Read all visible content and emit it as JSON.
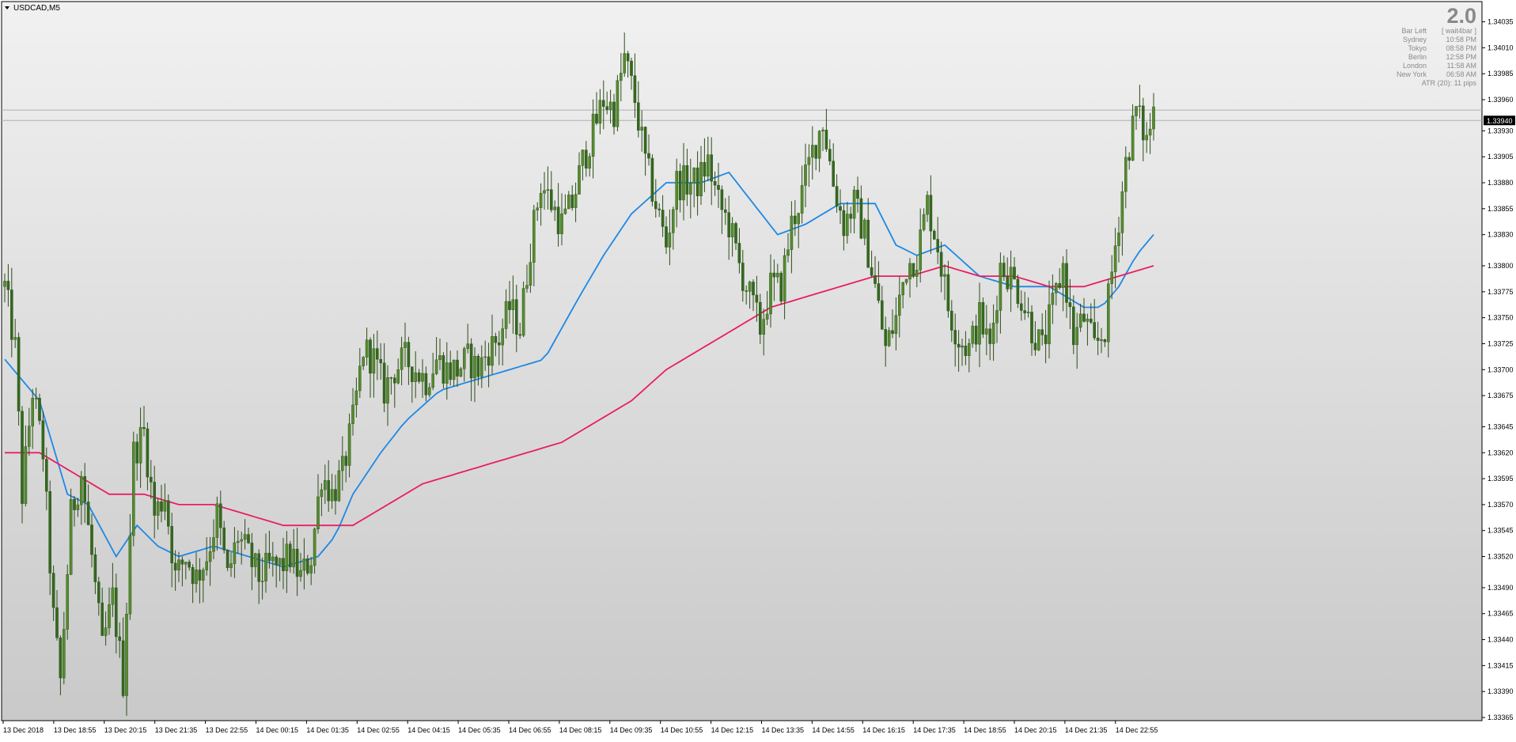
{
  "window": {
    "symbol_label": "USDCAD,M5"
  },
  "info_panel": {
    "version": "2.0",
    "rows": [
      {
        "label": "Bar Left",
        "value": "[ wait4bar ]"
      },
      {
        "label": "Sydney",
        "value": "10:58 PM"
      },
      {
        "label": "Tokyo",
        "value": "08:58 PM"
      },
      {
        "label": "Berlin",
        "value": "12:58 PM"
      },
      {
        "label": "London",
        "value": "11:58 AM"
      },
      {
        "label": "New York",
        "value": "06:58 AM"
      }
    ],
    "atr": "ATR (20): 11 pips"
  },
  "colors": {
    "bull_candle": "#558b2f",
    "bear_candle": "#33691e",
    "wick": "#2e4d1a",
    "ma_fast": "#1e88e5",
    "ma_slow": "#e91e63",
    "price_tag_bg": "#000000",
    "price_tag_fg": "#ffffff"
  },
  "chart_data": {
    "type": "candlestick",
    "title": "USDCAD,M5",
    "ylim": [
      1.33365,
      1.3404
    ],
    "y_ticks": [
      "1.34035",
      "1.34010",
      "1.33985",
      "1.33960",
      "1.33930",
      "1.33905",
      "1.33880",
      "1.33855",
      "1.33830",
      "1.33800",
      "1.33775",
      "1.33750",
      "1.33725",
      "1.33700",
      "1.33675",
      "1.33645",
      "1.33620",
      "1.33595",
      "1.33570",
      "1.33545",
      "1.33520",
      "1.33490",
      "1.33465",
      "1.33440",
      "1.33415",
      "1.33390",
      "1.33365"
    ],
    "x_ticks": [
      "13 Dec 2018",
      "13 Dec 18:55",
      "13 Dec 20:15",
      "13 Dec 21:35",
      "13 Dec 22:55",
      "14 Dec 00:15",
      "14 Dec 01:35",
      "14 Dec 02:55",
      "14 Dec 04:15",
      "14 Dec 05:35",
      "14 Dec 06:55",
      "14 Dec 08:15",
      "14 Dec 09:35",
      "14 Dec 10:55",
      "14 Dec 12:15",
      "14 Dec 13:35",
      "14 Dec 14:55",
      "14 Dec 16:15",
      "14 Dec 17:35",
      "14 Dec 18:55",
      "14 Dec 20:15",
      "14 Dec 21:35",
      "14 Dec 22:55"
    ],
    "current_price": "1.33940",
    "current_price_value": 1.3394,
    "horizontal_lines": [
      1.3395,
      1.3394
    ],
    "close_path": [
      [
        0,
        1.3378
      ],
      [
        3,
        1.3372
      ],
      [
        5,
        1.3358
      ],
      [
        8,
        1.3368
      ],
      [
        11,
        1.3362
      ],
      [
        14,
        1.3346
      ],
      [
        16,
        1.334
      ],
      [
        19,
        1.3356
      ],
      [
        22,
        1.336
      ],
      [
        25,
        1.3352
      ],
      [
        28,
        1.3343
      ],
      [
        31,
        1.3348
      ],
      [
        34,
        1.334
      ],
      [
        37,
        1.3362
      ],
      [
        40,
        1.3364
      ],
      [
        43,
        1.3356
      ],
      [
        46,
        1.3358
      ],
      [
        49,
        1.335
      ],
      [
        52,
        1.3352
      ],
      [
        55,
        1.335
      ],
      [
        58,
        1.3352
      ],
      [
        61,
        1.3356
      ],
      [
        64,
        1.335
      ],
      [
        67,
        1.3354
      ],
      [
        70,
        1.3352
      ],
      [
        73,
        1.335
      ],
      [
        76,
        1.3351
      ],
      [
        79,
        1.3351
      ],
      [
        82,
        1.3352
      ],
      [
        85,
        1.335
      ],
      [
        88,
        1.3352
      ],
      [
        91,
        1.336
      ],
      [
        94,
        1.3358
      ],
      [
        97,
        1.336
      ],
      [
        100,
        1.3365
      ],
      [
        103,
        1.3372
      ],
      [
        106,
        1.3371
      ],
      [
        109,
        1.3368
      ],
      [
        112,
        1.337
      ],
      [
        115,
        1.3371
      ],
      [
        118,
        1.337
      ],
      [
        121,
        1.3369
      ],
      [
        124,
        1.3371
      ],
      [
        127,
        1.337
      ],
      [
        130,
        1.337
      ],
      [
        133,
        1.3371
      ],
      [
        136,
        1.337
      ],
      [
        139,
        1.3372
      ],
      [
        142,
        1.3373
      ],
      [
        145,
        1.3376
      ],
      [
        148,
        1.3374
      ],
      [
        151,
        1.3382
      ],
      [
        154,
        1.3388
      ],
      [
        157,
        1.3386
      ],
      [
        160,
        1.3384
      ],
      [
        163,
        1.3386
      ],
      [
        166,
        1.339
      ],
      [
        169,
        1.3393
      ],
      [
        172,
        1.3396
      ],
      [
        175,
        1.3395
      ],
      [
        178,
        1.34
      ],
      [
        181,
        1.3396
      ],
      [
        184,
        1.339
      ],
      [
        187,
        1.3386
      ],
      [
        190,
        1.3382
      ],
      [
        193,
        1.3388
      ],
      [
        196,
        1.3388
      ],
      [
        199,
        1.3388
      ],
      [
        202,
        1.339
      ],
      [
        205,
        1.3386
      ],
      [
        208,
        1.3384
      ],
      [
        211,
        1.338
      ],
      [
        214,
        1.3377
      ],
      [
        217,
        1.3374
      ],
      [
        220,
        1.3378
      ],
      [
        223,
        1.3378
      ],
      [
        226,
        1.3384
      ],
      [
        229,
        1.3387
      ],
      [
        232,
        1.3391
      ],
      [
        235,
        1.3394
      ],
      [
        238,
        1.3388
      ],
      [
        241,
        1.3384
      ],
      [
        244,
        1.3386
      ],
      [
        247,
        1.3383
      ],
      [
        250,
        1.3378
      ],
      [
        253,
        1.3372
      ],
      [
        256,
        1.3375
      ],
      [
        259,
        1.338
      ],
      [
        262,
        1.3381
      ],
      [
        265,
        1.3386
      ],
      [
        268,
        1.3382
      ],
      [
        271,
        1.3376
      ],
      [
        274,
        1.3373
      ],
      [
        277,
        1.3372
      ],
      [
        280,
        1.3375
      ],
      [
        283,
        1.3372
      ],
      [
        286,
        1.338
      ],
      [
        289,
        1.3379
      ],
      [
        292,
        1.3377
      ],
      [
        295,
        1.3374
      ],
      [
        298,
        1.3372
      ],
      [
        301,
        1.3376
      ],
      [
        304,
        1.338
      ],
      [
        307,
        1.3373
      ],
      [
        310,
        1.3375
      ],
      [
        313,
        1.3372
      ],
      [
        316,
        1.3374
      ],
      [
        319,
        1.3382
      ],
      [
        322,
        1.339
      ],
      [
        325,
        1.3395
      ],
      [
        328,
        1.3392
      ],
      [
        330,
        1.3395
      ]
    ],
    "series": [
      {
        "name": "",
        "values": [
          [
            0,
            1.3371
          ],
          [
            10,
            1.3367
          ],
          [
            18,
            1.3358
          ],
          [
            24,
            1.3357
          ],
          [
            32,
            1.3352
          ],
          [
            38,
            1.3355
          ],
          [
            44,
            1.3353
          ],
          [
            50,
            1.3352
          ],
          [
            60,
            1.3353
          ],
          [
            70,
            1.3352
          ],
          [
            80,
            1.3351
          ],
          [
            90,
            1.3352
          ],
          [
            95,
            1.3354
          ],
          [
            100,
            1.3358
          ],
          [
            108,
            1.3362
          ],
          [
            115,
            1.3365
          ],
          [
            125,
            1.3368
          ],
          [
            135,
            1.3369
          ],
          [
            145,
            1.337
          ],
          [
            155,
            1.3371
          ],
          [
            165,
            1.3377
          ],
          [
            172,
            1.3381
          ],
          [
            180,
            1.3385
          ],
          [
            190,
            1.3388
          ],
          [
            200,
            1.3388
          ],
          [
            208,
            1.3389
          ],
          [
            215,
            1.3386
          ],
          [
            222,
            1.3383
          ],
          [
            230,
            1.3384
          ],
          [
            240,
            1.3386
          ],
          [
            250,
            1.3386
          ],
          [
            256,
            1.3382
          ],
          [
            262,
            1.3381
          ],
          [
            270,
            1.3382
          ],
          [
            280,
            1.3379
          ],
          [
            290,
            1.3378
          ],
          [
            300,
            1.3378
          ],
          [
            310,
            1.3376
          ],
          [
            315,
            1.3376
          ],
          [
            320,
            1.3378
          ],
          [
            325,
            1.3381
          ],
          [
            330,
            1.3383
          ]
        ]
      },
      {
        "name": "",
        "values": [
          [
            0,
            1.3362
          ],
          [
            10,
            1.3362
          ],
          [
            20,
            1.336
          ],
          [
            30,
            1.3358
          ],
          [
            40,
            1.3358
          ],
          [
            50,
            1.3357
          ],
          [
            60,
            1.3357
          ],
          [
            70,
            1.3356
          ],
          [
            80,
            1.3355
          ],
          [
            90,
            1.3355
          ],
          [
            100,
            1.3355
          ],
          [
            110,
            1.3357
          ],
          [
            120,
            1.3359
          ],
          [
            130,
            1.336
          ],
          [
            140,
            1.3361
          ],
          [
            150,
            1.3362
          ],
          [
            160,
            1.3363
          ],
          [
            170,
            1.3365
          ],
          [
            180,
            1.3367
          ],
          [
            190,
            1.337
          ],
          [
            200,
            1.3372
          ],
          [
            210,
            1.3374
          ],
          [
            220,
            1.3376
          ],
          [
            230,
            1.3377
          ],
          [
            240,
            1.3378
          ],
          [
            250,
            1.3379
          ],
          [
            260,
            1.3379
          ],
          [
            270,
            1.338
          ],
          [
            280,
            1.3379
          ],
          [
            290,
            1.3379
          ],
          [
            300,
            1.3378
          ],
          [
            310,
            1.3378
          ],
          [
            320,
            1.3379
          ],
          [
            330,
            1.338
          ]
        ]
      }
    ]
  }
}
